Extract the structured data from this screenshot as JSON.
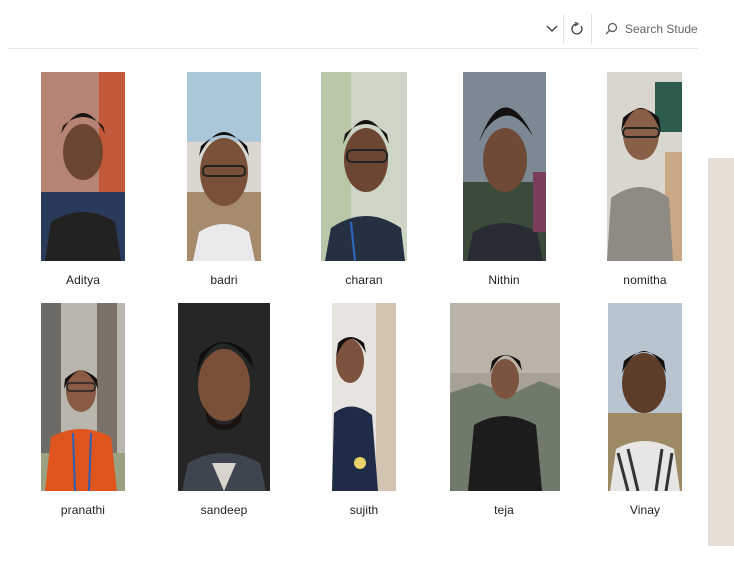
{
  "toolbar": {
    "chevron_icon": "chevron-down-icon",
    "refresh_icon": "refresh-icon",
    "search_icon": "search-icon",
    "search_placeholder": "Search Student_i"
  },
  "files": [
    {
      "name": "Aditya"
    },
    {
      "name": "badri"
    },
    {
      "name": "charan"
    },
    {
      "name": "Nithin"
    },
    {
      "name": "nomitha"
    },
    {
      "name": "pranathi"
    },
    {
      "name": "sandeep"
    },
    {
      "name": "sujith"
    },
    {
      "name": "teja"
    },
    {
      "name": "Vinay"
    }
  ]
}
